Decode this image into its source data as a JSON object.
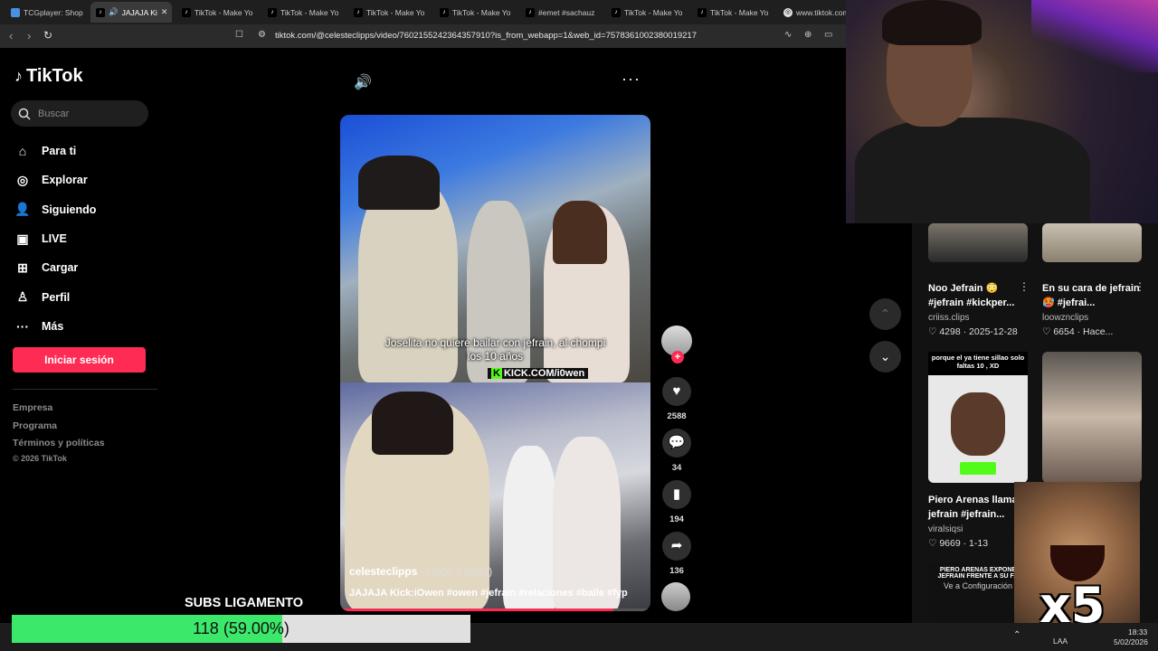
{
  "browser": {
    "tabs": [
      {
        "label": "TCGplayer: Shop"
      },
      {
        "label": "JAJAJA Ki"
      },
      {
        "label": "TikTok - Make Yo"
      },
      {
        "label": "TikTok - Make Yo"
      },
      {
        "label": "TikTok - Make Yo"
      },
      {
        "label": "TikTok - Make Yo"
      },
      {
        "label": "#emet #sachauz"
      },
      {
        "label": "TikTok - Make Yo"
      },
      {
        "label": "TikTok - Make Yo"
      },
      {
        "label": "www.tiktok.com"
      }
    ],
    "url": "tiktok.com/@celesteclipps/video/7602155242364357910?is_from_webapp=1&web_id=7578361002380019217"
  },
  "sidebar": {
    "logo": "TikTok",
    "search_placeholder": "Buscar",
    "items": [
      {
        "label": "Para ti",
        "icon": "home-icon"
      },
      {
        "label": "Explorar",
        "icon": "compass-icon"
      },
      {
        "label": "Siguiendo",
        "icon": "following-icon"
      },
      {
        "label": "LIVE",
        "icon": "live-icon"
      },
      {
        "label": "Cargar",
        "icon": "upload-icon"
      },
      {
        "label": "Perfil",
        "icon": "profile-icon"
      },
      {
        "label": "Más",
        "icon": "more-icon"
      }
    ],
    "login_button": "Iniciar sesión",
    "footer": [
      "Empresa",
      "Programa",
      "Términos y políticas"
    ],
    "copyright": "© 2026 TikTok"
  },
  "video": {
    "subtitle_line1": "Joselita no quiere bailar con jefrain, al chompi",
    "subtitle_line2": "los 10 años",
    "kick_tag": "KICK.COM/i0wen",
    "author": "celesteclipps",
    "time": "· Hace 3 día(s)",
    "caption": "JAJAJA Kick:iOwen #owen #jefrain #relaciones #baile #fyp",
    "progress": 0.88
  },
  "actions": {
    "likes": "2588",
    "comments": "34",
    "saves": "194",
    "shares": "136"
  },
  "recommendations": [
    {
      "title": "Noo Jefrain 😳 #jefrain #kickper...",
      "author": "criiss.clips",
      "likes": "4298",
      "date": "2025-12-28"
    },
    {
      "title": "En su cara de jefrain 🥵 #jefrai...",
      "author": "loowznclips",
      "likes": "6654",
      "date": "Hace..."
    },
    {
      "title": "Piero Arenas llama a jefrain #jefrain...",
      "author": "viralsiqsi",
      "likes": "9669",
      "date": "1-13",
      "overlay": "porque el ya tiene sillao solo faltas 10 , XD"
    },
    {
      "title": "",
      "overlay": "PIERO ARENAS EXPONE JEFRAIN FRENTE A SU FA",
      "sub": "Ve a Configuración"
    }
  ],
  "overlays": {
    "subs_label": "SUBS LIGAMENTO",
    "subs_text": "118 (59.00%)",
    "subs_progress": 0.59,
    "multiplier": "x5"
  },
  "taskbar": {
    "lang": "LAA",
    "time": "18:33",
    "date": "5/02/2026"
  }
}
